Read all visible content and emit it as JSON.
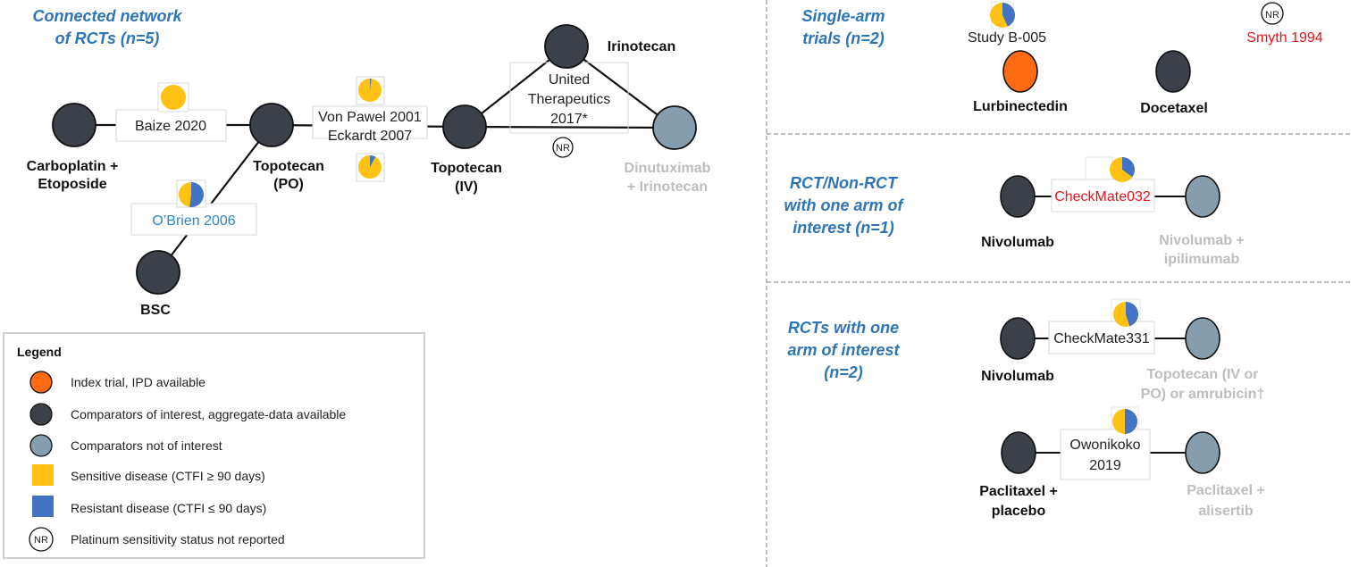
{
  "colors": {
    "index_trial": "#FF6A13",
    "comparator_interest": "#3B4049",
    "comparator_not_interest": "#869DAD",
    "sensitive": "#FFC114",
    "resistant": "#4472C4",
    "section_title": "#2E75B6",
    "grey_label": "#BDBDBD",
    "red_label": "#E8141C",
    "blue_label": "#2E86C8"
  },
  "sections": {
    "connected": {
      "title_line1": "Connected network",
      "title_line2": "of RCTs (n=5)"
    },
    "single_arm": {
      "title_line1": "Single-arm",
      "title_line2": "trials  (n=2)"
    },
    "rct_nonrct": {
      "title_line1": "RCT/Non-RCT",
      "title_line2": "with one arm of",
      "title_line3": "interest (n=1)"
    },
    "rct_one_arm": {
      "title_line1": "RCTs with one",
      "title_line2": "arm of interest",
      "title_line3": "(n=2)"
    }
  },
  "network": {
    "nodes": {
      "carboplatin": {
        "line1": "Carboplatin +",
        "line2": "Etoposide",
        "type": "comparator_interest"
      },
      "topotecan_po": {
        "line1": "Topotecan",
        "line2": "(PO)",
        "type": "comparator_interest"
      },
      "bsc": {
        "line1": "BSC",
        "type": "comparator_interest"
      },
      "topotecan_iv": {
        "line1": "Topotecan",
        "line2": "(IV)",
        "type": "comparator_interest"
      },
      "irinotecan": {
        "line1": "Irinotecan",
        "type": "comparator_interest"
      },
      "dinutuximab": {
        "line1": "Dinutuximab",
        "line2": "+ Irinotecan",
        "type": "comparator_not_interest"
      }
    },
    "trials": {
      "baize": {
        "label": "Baize 2020",
        "sensitive_pct": 100,
        "resistant_pct": 0
      },
      "obrien": {
        "label": "O’Brien 2006",
        "sensitive_pct": 48,
        "resistant_pct": 52
      },
      "vonpawel": {
        "label": "Von Pawel 2001",
        "sensitive_pct": 98,
        "resistant_pct": 2
      },
      "eckardt": {
        "label": "Eckardt 2007",
        "sensitive_pct": 92,
        "resistant_pct": 8
      },
      "united": {
        "line1": "United",
        "line2": "Therapeutics",
        "line3": "2017*",
        "status": "NR"
      }
    }
  },
  "single_arm": {
    "study_b005": {
      "label": "Study B-005",
      "sensitive_pct": 57,
      "resistant_pct": 43,
      "node": "Lurbinectedin",
      "type": "index_trial"
    },
    "smyth": {
      "label": "Smyth 1994",
      "status": "NR",
      "node": "Docetaxel",
      "type": "comparator_interest"
    }
  },
  "rct_nonrct": {
    "checkmate032": {
      "label": "CheckMate032",
      "sensitive_pct": 65,
      "resistant_pct": 35,
      "left": "Nivolumab",
      "right_line1": "Nivolumab +",
      "right_line2": "ipilimumab"
    }
  },
  "rct_one_arm": {
    "checkmate331": {
      "label": "CheckMate331",
      "sensitive_pct": 55,
      "resistant_pct": 45,
      "left": "Nivolumab",
      "right_line1": "Topotecan (IV or",
      "right_line2": "PO) or amrubicin†"
    },
    "owonikoko": {
      "line1": "Owonikoko",
      "line2": "2019",
      "sensitive_pct": 50,
      "resistant_pct": 50,
      "left_line1": "Paclitaxel +",
      "left_line2": "placebo",
      "right_line1": "Paclitaxel +",
      "right_line2": "alisertib"
    }
  },
  "legend": {
    "title": "Legend",
    "items": [
      {
        "label": "Index trial, IPD available",
        "symbol": "index_trial"
      },
      {
        "label": "Comparators of interest, aggregate-data available",
        "symbol": "comparator_interest"
      },
      {
        "label": "Comparators not of interest",
        "symbol": "comparator_not_interest"
      },
      {
        "label": "Sensitive disease (CTFI ≥ 90 days)",
        "symbol": "sensitive"
      },
      {
        "label": "Resistant disease (CTFI ≤ 90 days)",
        "symbol": "resistant"
      },
      {
        "label": "Platinum sensitivity status not reported",
        "symbol": "nr"
      }
    ],
    "nr_text": "NR"
  }
}
